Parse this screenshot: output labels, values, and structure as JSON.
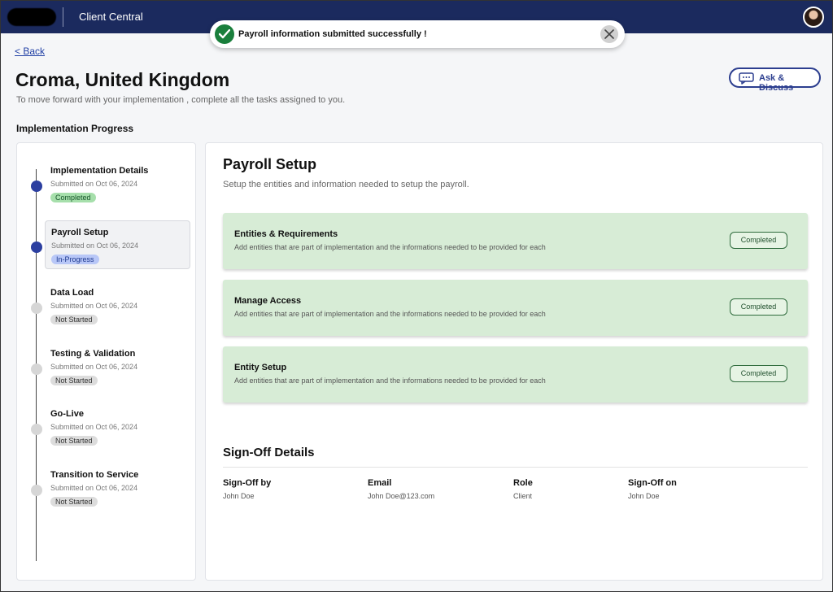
{
  "header": {
    "app_title": "Client Central"
  },
  "toast": {
    "message": "Payroll information submitted successfully !"
  },
  "page": {
    "back_label": "< Back",
    "title": "Croma, United Kingdom",
    "subtitle": "To move forward with your implementation , complete all the tasks assigned to you.",
    "ask_label": "Ask & Discuss",
    "progress_heading": "Implementation Progress"
  },
  "steps": [
    {
      "title": "Implementation Details",
      "date": "Submitted on Oct 06, 2024",
      "status": "Completed"
    },
    {
      "title": "Payroll Setup",
      "date": "Submitted on Oct 06, 2024",
      "status": "In-Progress"
    },
    {
      "title": "Data Load",
      "date": "Submitted on Oct 06, 2024",
      "status": "Not Started"
    },
    {
      "title": "Testing & Validation",
      "date": "Submitted on Oct 06, 2024",
      "status": "Not Started"
    },
    {
      "title": "Go-Live",
      "date": "Submitted on Oct 06, 2024",
      "status": "Not Started"
    },
    {
      "title": "Transition to Service",
      "date": "Submitted on Oct 06, 2024",
      "status": "Not Started"
    }
  ],
  "main": {
    "title": "Payroll Setup",
    "subtitle": "Setup the entities and information needed to setup the payroll.",
    "tasks": [
      {
        "title": "Entities & Requirements",
        "desc": "Add entities that are part of implementation and the informations needed to be provided for each",
        "status": "Completed"
      },
      {
        "title": "Manage Access",
        "desc": "Add entities that are part of implementation and the informations needed to be provided for each",
        "status": "Completed"
      },
      {
        "title": "Entity Setup",
        "desc": "Add entities that are part of implementation and the informations needed to be provided for each",
        "status": "Completed"
      }
    ]
  },
  "signoff": {
    "title": "Sign-Off Details",
    "columns": [
      {
        "label": "Sign-Off by",
        "value": "John Doe"
      },
      {
        "label": "Email",
        "value": "John Doe@123.com"
      },
      {
        "label": "Role",
        "value": "Client"
      },
      {
        "label": "Sign-Off on",
        "value": "John Doe"
      }
    ]
  }
}
